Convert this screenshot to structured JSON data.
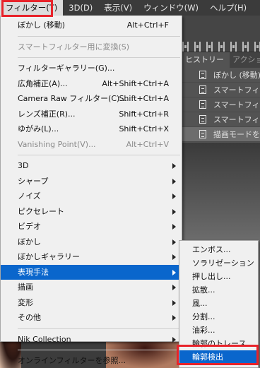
{
  "menubar": {
    "items": [
      {
        "label": "フィルター(T)",
        "active": true
      },
      {
        "label": "3D(D)"
      },
      {
        "label": "表示(V)"
      },
      {
        "label": "ウィンドウ(W)"
      },
      {
        "label": "ヘルプ(H)"
      }
    ]
  },
  "history_panel": {
    "tabs": [
      "ヒストリー",
      "アクション"
    ],
    "rows": [
      "ぼかし (移動)",
      "スマートフィルター",
      "スマートフィルター",
      "スマートフィルター",
      "描画モードを変更"
    ]
  },
  "filter_menu": {
    "blur_move": {
      "label": "ぼかし (移動)",
      "shortcut": "Alt+Ctrl+F"
    },
    "convert_smart": {
      "label": "スマートフィルター用に変換(S)"
    },
    "gallery": {
      "label": "フィルターギャラリー(G)..."
    },
    "wide_angle": {
      "label": "広角補正(A)...",
      "shortcut": "Alt+Shift+Ctrl+A"
    },
    "camera_raw": {
      "label": "Camera Raw フィルター(C)...",
      "shortcut": "Shift+Ctrl+A"
    },
    "lens_correction": {
      "label": "レンズ補正(R)...",
      "shortcut": "Shift+Ctrl+R"
    },
    "liquify": {
      "label": "ゆがみ(L)...",
      "shortcut": "Shift+Ctrl+X"
    },
    "vanishing_point": {
      "label": "Vanishing Point(V)...",
      "shortcut": "Alt+Ctrl+V"
    },
    "submenus": [
      "3D",
      "シャープ",
      "ノイズ",
      "ピクセレート",
      "ビデオ",
      "ぼかし",
      "ぼかしギャラリー",
      "表現手法",
      "描画",
      "変形",
      "その他"
    ],
    "nik": {
      "label": "Nik Collection"
    },
    "browse_online": {
      "label": "オンラインフィルターを参照..."
    }
  },
  "stylize_submenu": {
    "items": [
      "エンボス...",
      "ソラリゼーション",
      "押し出し...",
      "拡散...",
      "風...",
      "分割...",
      "油彩...",
      "輪郭のトレース...",
      "輪郭検出"
    ]
  },
  "colors": {
    "highlight_blue": "#0a66cc",
    "callout_red": "#e8232a"
  }
}
